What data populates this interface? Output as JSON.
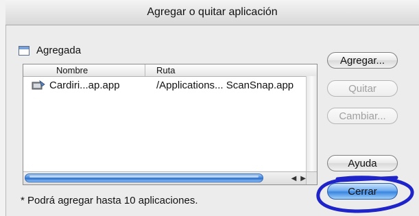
{
  "window": {
    "title": "Agregar o quitar aplicación"
  },
  "section": {
    "label": "Agregada",
    "icon": "window-icon"
  },
  "list": {
    "columns": [
      "Nombre",
      "Ruta"
    ],
    "rows": [
      {
        "name": "Cardiri...ap.app",
        "path": "/Applications... ScanSnap.app",
        "icon": "app-icon"
      }
    ]
  },
  "buttons": {
    "agregar": "Agregar...",
    "quitar": "Quitar",
    "cambiar": "Cambiar...",
    "ayuda": "Ayuda",
    "cerrar": "Cerrar"
  },
  "footnote": "* Podrá agregar hasta 10 aplicaciones.",
  "colors": {
    "highlight_circle": "#1f24c8",
    "default_button": "#3b86e0",
    "scroll_thumb": "#4c8ee0"
  }
}
